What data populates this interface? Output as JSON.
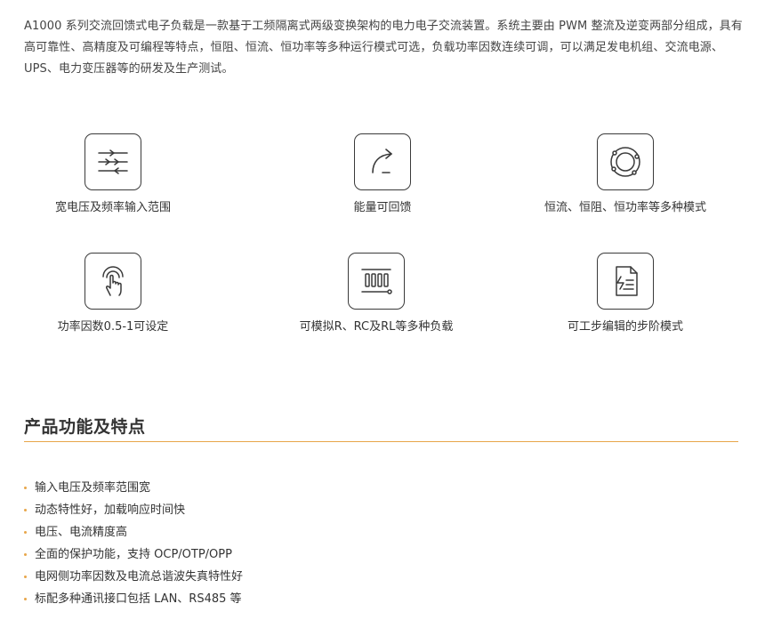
{
  "intro": {
    "text": "A1000 系列交流回馈式电子负载是一款基于工频隔离式两级变换架构的电力电子交流装置。系统主要由 PWM 整流及逆变两部分组成，具有高可靠性、高精度及可编程等特点，恒阻、恒流、恒功率等多种运行模式可选，负载功率因数连续可调，可以满足发电机组、交流电源、UPS、电力变压器等的研发及生产测试。"
  },
  "features": [
    {
      "label": "宽电压及频率输入范围",
      "icon": "sliders-arrows-icon"
    },
    {
      "label": "能量可回馈",
      "icon": "feedback-arrow-icon"
    },
    {
      "label": "恒流、恒阻、恒功率等多种模式",
      "icon": "orbit-rings-icon"
    },
    {
      "label": "功率因数0.5-1可设定",
      "icon": "touch-hand-icon"
    },
    {
      "label": "可模拟R、RC及RL等多种负载",
      "icon": "resistor-bank-icon"
    },
    {
      "label": "可工步编辑的步阶模式",
      "icon": "document-step-icon"
    }
  ],
  "section": {
    "title": "产品功能及特点"
  },
  "points": [
    "输入电压及频率范围宽",
    "动态特性好，加载响应时间快",
    "电压、电流精度高",
    "全面的保护功能，支持 OCP/OTP/OPP",
    "电网侧功率因数及电流总谐波失真特性好",
    "标配多种通讯接口包括 LAN、RS485 等"
  ],
  "colors": {
    "accent": "#e8a64a",
    "text": "#333333",
    "icon_stroke": "#3a3a3a"
  }
}
